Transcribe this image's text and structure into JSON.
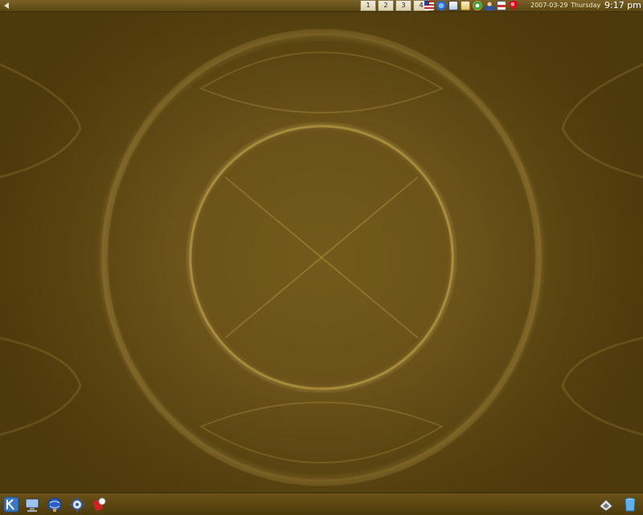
{
  "top_panel": {
    "pager": [
      "1",
      "2",
      "3",
      "4"
    ],
    "tray_icons": [
      "us-flag-icon",
      "volume-icon",
      "network-icon",
      "clipboard-icon",
      "update-icon",
      "user-icon",
      "printer-icon",
      "ruby-icon"
    ],
    "date": "2007-03-29",
    "day": "Thursday",
    "time": "9:17 pm"
  },
  "bottom_panel": {
    "launchers": [
      "kde-menu-icon",
      "desktop-icon",
      "browser-icon",
      "settings-icon",
      "rescue-icon"
    ],
    "right_icons": [
      "devices-icon",
      "trash-icon"
    ]
  },
  "colors": {
    "panel": "#6a5218",
    "wallpaper_glow": "#c9a94a"
  }
}
